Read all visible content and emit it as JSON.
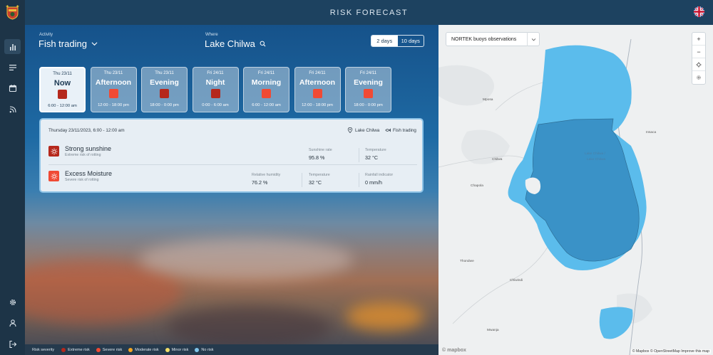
{
  "header": {
    "title": "RISK FORECAST"
  },
  "sidebar": {
    "items": [
      {
        "icon": "bar-chart-icon"
      },
      {
        "icon": "list-icon"
      },
      {
        "icon": "calendar-icon"
      },
      {
        "icon": "signal-icon"
      }
    ],
    "bottom": [
      {
        "icon": "gear-icon"
      },
      {
        "icon": "user-icon"
      },
      {
        "icon": "logout-icon"
      }
    ]
  },
  "controls": {
    "activity_label": "Activity",
    "activity_value": "Fish trading",
    "where_label": "Where",
    "where_value": "Lake Chilwa",
    "range_options": [
      "2 days",
      "10 days"
    ],
    "range_selected": "2 days"
  },
  "slots": [
    {
      "day": "Thu 23/11",
      "part": "Now",
      "time": "6:00 - 12:00 am",
      "color": "#b5281c"
    },
    {
      "day": "Thu 23/11",
      "part": "Afternoon",
      "time": "12:00 - 18:00 pm",
      "color": "#f04a34"
    },
    {
      "day": "Thu 23/11",
      "part": "Evening",
      "time": "18:00 - 0:00 pm",
      "color": "#b5281c"
    },
    {
      "day": "Fri 24/11",
      "part": "Night",
      "time": "0:00 - 6:00 am",
      "color": "#b5281c"
    },
    {
      "day": "Fri 24/11",
      "part": "Morning",
      "time": "6:00 - 12:00 am",
      "color": "#f04a34"
    },
    {
      "day": "Fri 24/11",
      "part": "Afternoon",
      "time": "12:00 - 18:00 pm",
      "color": "#f04a34"
    },
    {
      "day": "Fri 24/11",
      "part": "Evening",
      "time": "18:00 - 0:00 pm",
      "color": "#f04a34"
    }
  ],
  "details": {
    "date": "Thursday 23/11/2023, 6:00 - 12:00 am",
    "location": "Lake Chilwa",
    "activity": "Fish trading",
    "risks": [
      {
        "name": "Strong sunshine",
        "subtitle": "Extreme risk of rotting",
        "color": "#b5281c",
        "metrics": [
          {
            "label": "Sunshine rate",
            "value": "95.8 %"
          },
          {
            "label": "Temperature",
            "value": "32 °C"
          }
        ]
      },
      {
        "name": "Excess Moisture",
        "subtitle": "Severe risk of rotting",
        "color": "#f04a34",
        "metrics": [
          {
            "label": "Relative humidity",
            "value": "76.2 %"
          },
          {
            "label": "Temperature",
            "value": "32 °C"
          },
          {
            "label": "Rainfall indicator",
            "value": "0 mm/h"
          }
        ]
      }
    ]
  },
  "legend": {
    "title": "Risk severity",
    "items": [
      {
        "label": "Extreme risk",
        "color": "#b5281c"
      },
      {
        "label": "Severe risk",
        "color": "#f04a34"
      },
      {
        "label": "Moderate risk",
        "color": "#f5a623"
      },
      {
        "label": "Minor risk",
        "color": "#f1de6a"
      },
      {
        "label": "No risk",
        "color": "#7fc4ea"
      }
    ]
  },
  "map": {
    "layer_select": "NORTEK buoys observations",
    "controls": [
      "+",
      "−"
    ],
    "places": {
      "mposa": "Mposa",
      "insaca": "Insaca",
      "chilwa": "Chilwa",
      "lake_label_1": "Lake Chilwa /",
      "lake_label_2": "Lake Chilwa",
      "chapola": "Chapola",
      "thondwe": "Thondwe",
      "chiwindi": "Chiwindi",
      "mwanja": "Mwanja"
    },
    "attribution": "© Mapbox © OpenStreetMap Improve this map",
    "logo": "© mapbox"
  }
}
